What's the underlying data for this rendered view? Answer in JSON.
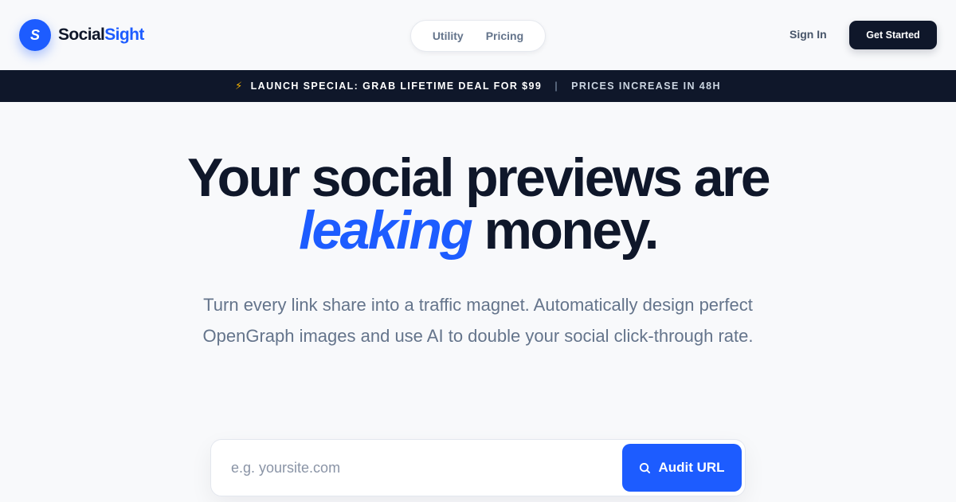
{
  "brand": {
    "logo_letter": "S",
    "name_primary": "Social",
    "name_accent": "Sight"
  },
  "nav": {
    "items": [
      {
        "label": "Utility"
      },
      {
        "label": "Pricing"
      }
    ]
  },
  "header_actions": {
    "sign_in": "Sign In",
    "get_started": "Get Started"
  },
  "banner": {
    "icon": "lightning-bolt-icon",
    "icon_glyph": "⚡",
    "deal": "LAUNCH SPECIAL: GRAB LIFETIME DEAL FOR $99",
    "separator": "|",
    "urgency": "PRICES INCREASE IN 48H"
  },
  "hero": {
    "headline_line1": "Your social previews are",
    "headline_accent": "leaking",
    "headline_line2_rest": " money.",
    "subcopy": "Turn every link share into a traffic magnet. Automatically design perfect OpenGraph images and use AI to double your social click-through rate."
  },
  "search": {
    "placeholder": "e.g. yoursite.com",
    "value": "",
    "button_label": "Audit URL",
    "button_icon": "search-icon"
  },
  "colors": {
    "brand_blue": "#1d5cff",
    "navy": "#0f172a",
    "banner_bolt": "#f5b301",
    "muted_text": "#64748b"
  }
}
